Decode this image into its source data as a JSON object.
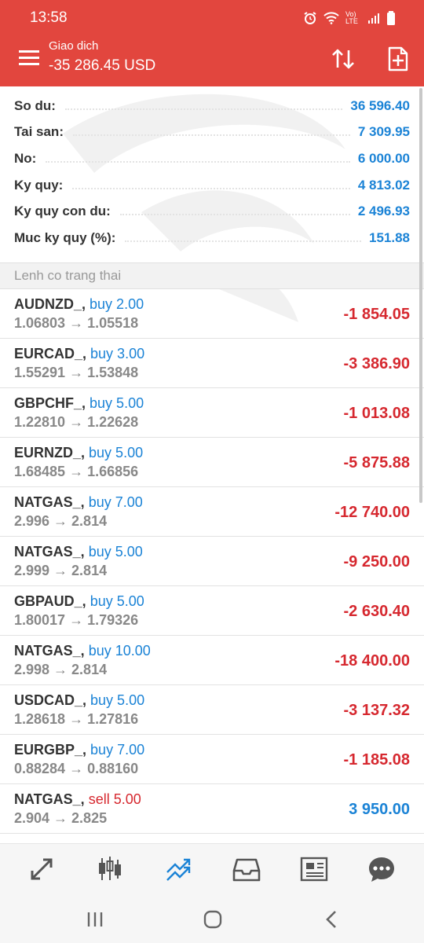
{
  "status_bar": {
    "time": "13:58",
    "network": "Vo) LTE"
  },
  "header": {
    "title": "Giao dich",
    "balance_display": "-35 286.45 USD"
  },
  "summary": [
    {
      "label": "So du:",
      "value": "36 596.40"
    },
    {
      "label": "Tai san:",
      "value": "7 309.95"
    },
    {
      "label": "No:",
      "value": "6 000.00"
    },
    {
      "label": "Ky quy:",
      "value": "4 813.02"
    },
    {
      "label": "Ky quy con du:",
      "value": "2 496.93"
    },
    {
      "label": "Muc ky quy (%):",
      "value": "151.88"
    }
  ],
  "section_title": "Lenh co trang thai",
  "positions": [
    {
      "symbol": "AUDNZD_,",
      "side": "buy 2.00",
      "type": "buy",
      "prices": "1.06803 → 1.05518",
      "pnl": "-1 854.05",
      "sign": "neg"
    },
    {
      "symbol": "EURCAD_,",
      "side": "buy 3.00",
      "type": "buy",
      "prices": "1.55291 → 1.53848",
      "pnl": "-3 386.90",
      "sign": "neg"
    },
    {
      "symbol": "GBPCHF_,",
      "side": "buy 5.00",
      "type": "buy",
      "prices": "1.22810 → 1.22628",
      "pnl": "-1 013.08",
      "sign": "neg"
    },
    {
      "symbol": "EURNZD_,",
      "side": "buy 5.00",
      "type": "buy",
      "prices": "1.68485 → 1.66856",
      "pnl": "-5 875.88",
      "sign": "neg"
    },
    {
      "symbol": "NATGAS_,",
      "side": "buy 7.00",
      "type": "buy",
      "prices": "2.996 → 2.814",
      "pnl": "-12 740.00",
      "sign": "neg"
    },
    {
      "symbol": "NATGAS_,",
      "side": "buy 5.00",
      "type": "buy",
      "prices": "2.999 → 2.814",
      "pnl": "-9 250.00",
      "sign": "neg"
    },
    {
      "symbol": "GBPAUD_,",
      "side": "buy 5.00",
      "type": "buy",
      "prices": "1.80017 → 1.79326",
      "pnl": "-2 630.40",
      "sign": "neg"
    },
    {
      "symbol": "NATGAS_,",
      "side": "buy 10.00",
      "type": "buy",
      "prices": "2.998 → 2.814",
      "pnl": "-18 400.00",
      "sign": "neg"
    },
    {
      "symbol": "USDCAD_,",
      "side": "buy 5.00",
      "type": "buy",
      "prices": "1.28618 → 1.27816",
      "pnl": "-3 137.32",
      "sign": "neg"
    },
    {
      "symbol": "EURGBP_,",
      "side": "buy 7.00",
      "type": "buy",
      "prices": "0.88284 → 0.88160",
      "pnl": "-1 185.08",
      "sign": "neg"
    },
    {
      "symbol": "NATGAS_,",
      "side": "sell 5.00",
      "type": "sell",
      "prices": "2.904 → 2.825",
      "pnl": "3 950.00",
      "sign": "pos"
    }
  ],
  "colors": {
    "header": "#e2463e",
    "blue": "#1b83d6",
    "red": "#d6282f"
  },
  "bottom_nav": [
    "quotes-icon",
    "chart-icon",
    "trade-icon",
    "history-icon",
    "news-icon",
    "chat-icon"
  ]
}
